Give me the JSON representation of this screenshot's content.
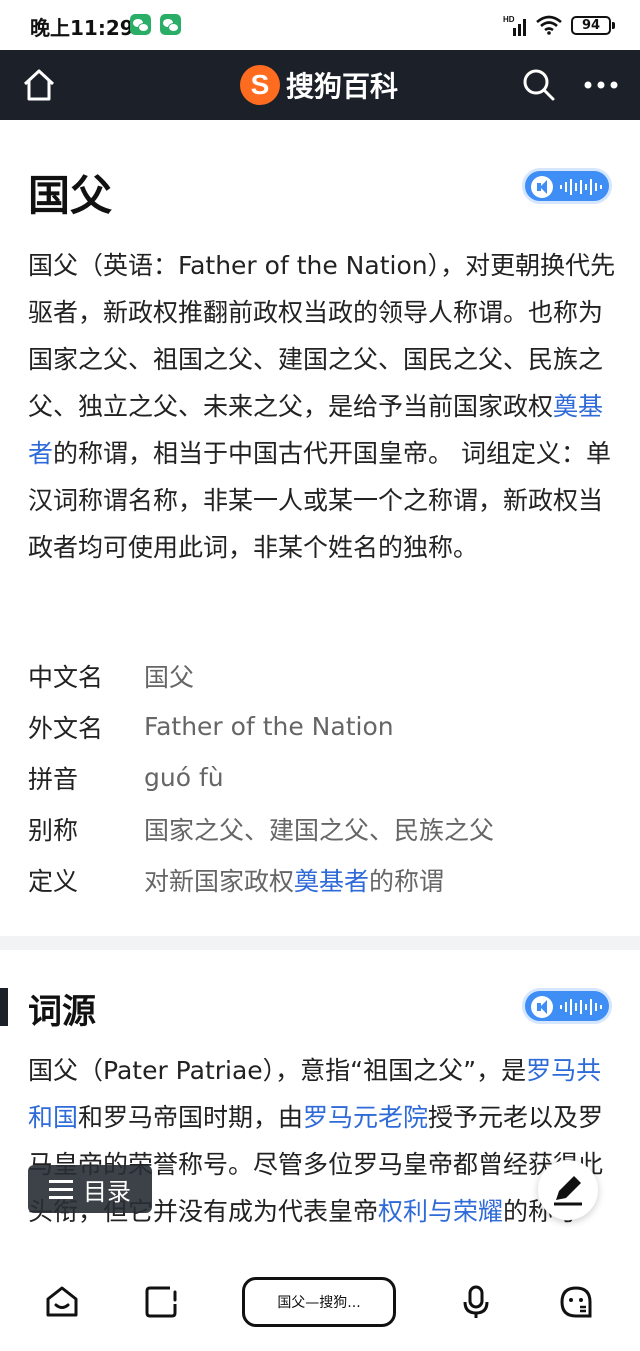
{
  "status_bar": {
    "time": "晚上11:29",
    "network": "HD",
    "battery": "94"
  },
  "header": {
    "logo_text": "搜狗百科",
    "logo_mark": "S",
    "icons": [
      "home-icon",
      "search-icon",
      "more-icon"
    ]
  },
  "article": {
    "title": "国父",
    "intro": {
      "t1": "国父（英语：Father of the Nation），对更朝换代先驱者，新政权推翻前政权当政的领导人称谓。也称为国家之父、祖国之父、建国之父、国民之父、民族之父、独立之父、未来之父，是给予当前国家政权",
      "link1": "奠基者",
      "t2": "的称谓，相当于中国古代开国皇帝。 词组定义：单汉词称谓名称，非某一人或某一个之称谓，新政权当政者均可使用此词，非某个姓名的独称。"
    },
    "info": [
      {
        "label": "中文名",
        "value": "国父"
      },
      {
        "label": "外文名",
        "value": "Father of the Nation"
      },
      {
        "label": "拼音",
        "value": "guó fù"
      },
      {
        "label": "别称",
        "value": "国家之父、建国之父、民族之父"
      },
      {
        "label": "定义",
        "value_pre": "对新国家政权",
        "value_link": "奠基者",
        "value_post": "的称谓"
      }
    ],
    "section": {
      "title": "词源",
      "t1": "国父（Pater Patriae），意指“祖国之父”，是",
      "link1": "罗马共和国",
      "t2": "和罗马帝国时期，由",
      "link2": "罗马元老院",
      "t3": "授予元老以及罗马皇帝的荣誉称号。尽管多位罗马皇帝都曾经获得此头衔，但它并没有成为代表皇帝",
      "link3": "权利与荣耀",
      "t4": "的称号"
    }
  },
  "floating": {
    "toc_label": "目录"
  },
  "bottom_bar": {
    "url_label": "国父—搜狗..."
  }
}
